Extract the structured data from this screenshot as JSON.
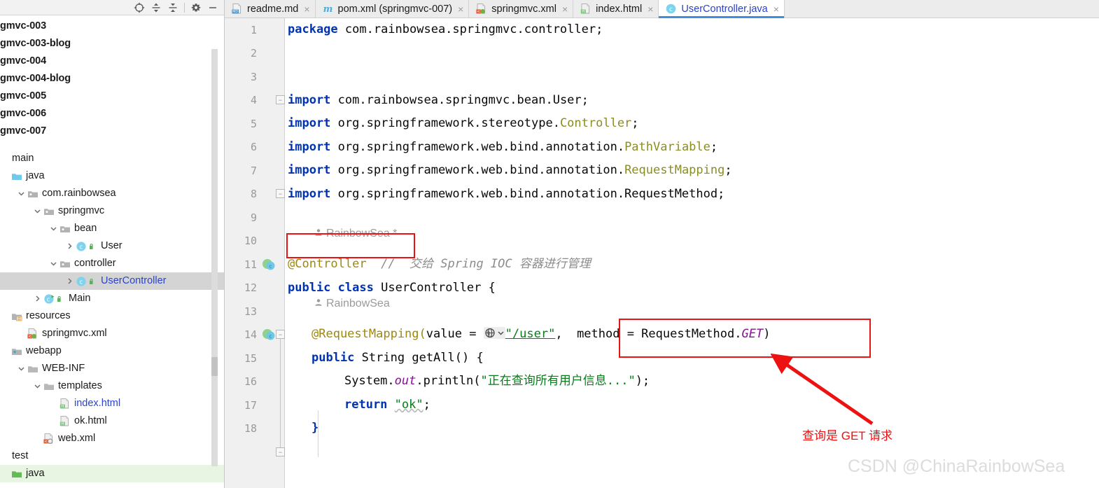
{
  "sidebar": {
    "toolbar": [
      {
        "name": "locate-target-icon",
        "label": "locate"
      },
      {
        "name": "expand-all-icon",
        "label": "expand all"
      },
      {
        "name": "collapse-all-icon",
        "label": "collapse all"
      },
      {
        "name": "settings-gear-icon",
        "label": "settings"
      },
      {
        "name": "hide-panel-icon",
        "label": "hide"
      }
    ],
    "tree": [
      {
        "label": "gmvc-003",
        "kind": "module",
        "indent": 0,
        "chevron": "",
        "icon": "none"
      },
      {
        "label": "gmvc-003-blog",
        "kind": "module",
        "indent": 0,
        "chevron": "",
        "icon": "none"
      },
      {
        "label": "gmvc-004",
        "kind": "module",
        "indent": 0,
        "chevron": "",
        "icon": "none"
      },
      {
        "label": "gmvc-004-blog",
        "kind": "module",
        "indent": 0,
        "chevron": "",
        "icon": "none"
      },
      {
        "label": "gmvc-005",
        "kind": "module",
        "indent": 0,
        "chevron": "",
        "icon": "none"
      },
      {
        "label": "gmvc-006",
        "kind": "module",
        "indent": 0,
        "chevron": "",
        "icon": "none"
      },
      {
        "label": "gmvc-007",
        "kind": "module",
        "indent": 0,
        "chevron": "",
        "icon": "none"
      },
      {
        "label": "",
        "kind": "spacer",
        "indent": 0,
        "chevron": "",
        "icon": "none"
      },
      {
        "label": "main",
        "kind": "folder-plain",
        "indent": 0,
        "chevron": "",
        "icon": "none"
      },
      {
        "label": "java",
        "kind": "source-folder",
        "indent": 0,
        "chevron": "",
        "icon": "folder-blue"
      },
      {
        "label": "com.rainbowsea",
        "kind": "package",
        "indent": 1,
        "chevron": "down",
        "icon": "package"
      },
      {
        "label": "springmvc",
        "kind": "package",
        "indent": 2,
        "chevron": "down",
        "icon": "package"
      },
      {
        "label": "bean",
        "kind": "package",
        "indent": 3,
        "chevron": "down",
        "icon": "package"
      },
      {
        "label": "User",
        "kind": "class",
        "indent": 4,
        "chevron": "right",
        "icon": "class"
      },
      {
        "label": "controller",
        "kind": "package",
        "indent": 3,
        "chevron": "down",
        "icon": "package"
      },
      {
        "label": "UserController",
        "kind": "class",
        "indent": 4,
        "chevron": "right",
        "icon": "class",
        "selected": true,
        "blue": true
      },
      {
        "label": "Main",
        "kind": "class-run",
        "indent": 2,
        "chevron": "right",
        "icon": "class-run"
      },
      {
        "label": "resources",
        "kind": "resources-folder",
        "indent": 0,
        "chevron": "",
        "icon": "folder-resources"
      },
      {
        "label": "springmvc.xml",
        "kind": "xml-spring",
        "indent": 1,
        "chevron": "",
        "icon": "xml-spring"
      },
      {
        "label": "webapp",
        "kind": "webapp-folder",
        "indent": 0,
        "chevron": "",
        "icon": "folder-webapp"
      },
      {
        "label": "WEB-INF",
        "kind": "folder",
        "indent": 1,
        "chevron": "down",
        "icon": "folder-gray"
      },
      {
        "label": "templates",
        "kind": "folder",
        "indent": 2,
        "chevron": "down",
        "icon": "folder-gray"
      },
      {
        "label": "index.html",
        "kind": "html",
        "indent": 3,
        "chevron": "",
        "icon": "html",
        "blue": true
      },
      {
        "label": "ok.html",
        "kind": "html",
        "indent": 3,
        "chevron": "",
        "icon": "html"
      },
      {
        "label": "web.xml",
        "kind": "xml-web",
        "indent": 2,
        "chevron": "",
        "icon": "xml-web"
      },
      {
        "label": "test",
        "kind": "folder-plain",
        "indent": 0,
        "chevron": "",
        "icon": "none"
      },
      {
        "label": "java",
        "kind": "test-source-folder",
        "indent": 0,
        "chevron": "",
        "icon": "folder-green",
        "green": true
      }
    ]
  },
  "tabs": [
    {
      "label": "readme.md",
      "icon": "markdown-file-icon",
      "active": false,
      "closable": true
    },
    {
      "label": "pom.xml (springmvc-007)",
      "icon": "maven-file-icon",
      "active": false,
      "closable": true
    },
    {
      "label": "springmvc.xml",
      "icon": "spring-xml-file-icon",
      "active": false,
      "closable": true
    },
    {
      "label": "index.html",
      "icon": "html-file-icon",
      "active": false,
      "closable": true
    },
    {
      "label": "UserController.java",
      "icon": "java-class-file-icon",
      "active": true,
      "closable": true
    }
  ],
  "editor": {
    "filename": "UserController.java",
    "line_numbers": [
      1,
      2,
      3,
      4,
      5,
      6,
      7,
      8,
      9,
      10,
      11,
      12,
      13,
      14,
      15,
      16,
      17,
      18
    ],
    "lines": [
      {
        "num": 1,
        "text": "package com.rainbowsea.springmvc.controller;"
      },
      {
        "num": 2,
        "text": ""
      },
      {
        "num": 3,
        "text": ""
      },
      {
        "num": 4,
        "text": "import com.rainbowsea.springmvc.bean.User;"
      },
      {
        "num": 5,
        "text": "import org.springframework.stereotype.Controller;"
      },
      {
        "num": 6,
        "text": "import org.springframework.web.bind.annotation.PathVariable;"
      },
      {
        "num": 7,
        "text": "import org.springframework.web.bind.annotation.RequestMapping;"
      },
      {
        "num": 8,
        "text": "import org.springframework.web.bind.annotation.RequestMethod;"
      },
      {
        "num": 9,
        "text": ""
      },
      {
        "num": 10,
        "text": "@Controller  // 交给 Spring IOC 容器进行管理"
      },
      {
        "num": 11,
        "text": "public class UserController {"
      },
      {
        "num": 12,
        "text": ""
      },
      {
        "num": 13,
        "text": "@RequestMapping(value = \"/user\", method = RequestMethod.GET)"
      },
      {
        "num": 14,
        "text": "public String getAll() {"
      },
      {
        "num": 15,
        "text": "System.out.println(\"正在查询所有用户信息...\");"
      },
      {
        "num": 16,
        "text": "return \"ok\";"
      },
      {
        "num": 17,
        "text": "}"
      },
      {
        "num": 18,
        "text": ""
      }
    ],
    "code": {
      "l1_package_kw": "package",
      "l1_package_name": " com.rainbowsea.springmvc.controller;",
      "l4_import": "import",
      "l4_rest": " com.rainbowsea.springmvc.bean.",
      "l4_type": "User",
      "l4_semi": ";",
      "l5_rest": " org.springframework.stereotype.",
      "l5_type": "Controller",
      "l6_rest": " org.springframework.web.bind.annotation.",
      "l6_type": "PathVariable",
      "l7_rest": " org.springframework.web.bind.annotation.",
      "l7_type": "RequestMapping",
      "l8_rest": " org.springframework.web.bind.annotation.RequestMethod;",
      "l10_author": "RainbowSea *",
      "l10_anno": "@Controller",
      "l10_slashes": "//",
      "l10_comment": "交给 Spring IOC 容器进行管理",
      "l11_public": "public",
      "l11_class": "class",
      "l11_name": "UserController",
      "l11_brace": "{",
      "l13_author": "RainbowSea",
      "l13_anno": "@RequestMapping(",
      "l13_value": "value",
      "l13_eq": " = ",
      "l13_url": "\"/user\"",
      "l13_comma": ",",
      "l13_method": "method = RequestMethod.",
      "l13_get": "GET",
      "l13_close": ")",
      "l14_public": "public",
      "l14_string": "String",
      "l14_method": "getAll() {",
      "l15_system": "System.",
      "l15_out": "out",
      "l15_println": ".println(",
      "l15_str": "\"正在查询所有用户信息...\"",
      "l15_end": ");",
      "l16_return": "return",
      "l16_str": "\"ok\"",
      "l16_semi": ";",
      "l17_brace": "}"
    }
  },
  "annotations": {
    "red_label": "查询是 GET 请求",
    "watermark": "CSDN @ChinaRainbowSea",
    "box_controller": "@Controller //",
    "box_method": "method = RequestMethod.GET)"
  },
  "colors": {
    "accent_blue": "#3c8ede",
    "annotation_red": "#ee1111",
    "link_blue": "#2b44c7",
    "string_green": "#067d17",
    "keyword_blue": "#0033b3",
    "annotation_gold": "#9e880d",
    "type_olive": "#8c8c24",
    "comment_gray": "#8c8c8c",
    "watermark_gray": "#dcdcdc",
    "selected_row": "#d4d4d4",
    "test_row_green": "#e7f5e2"
  }
}
